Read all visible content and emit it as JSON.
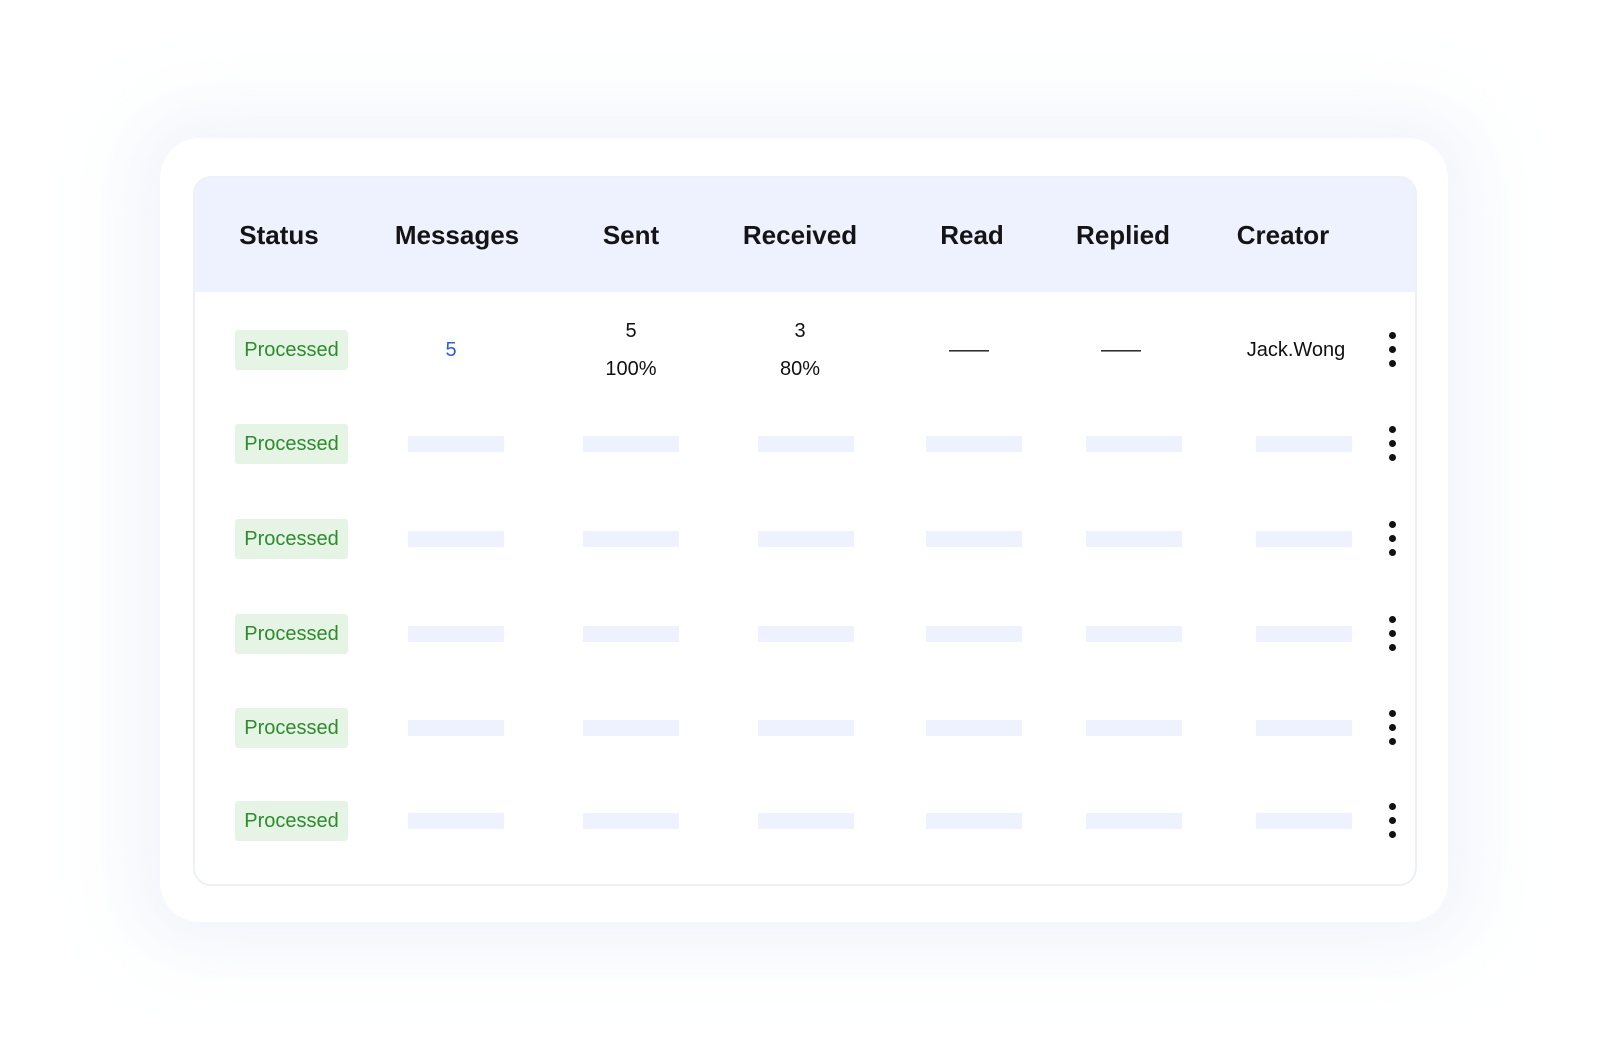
{
  "table": {
    "columns": [
      "Status",
      "Messages",
      "Sent",
      "Received",
      "Read",
      "Replied",
      "Creator"
    ],
    "rows": [
      {
        "status": "Processed",
        "messages": "5",
        "sent_count": "5",
        "sent_pct": "100%",
        "received_count": "3",
        "received_pct": "80%",
        "read": "——",
        "replied": "——",
        "creator": "Jack.Wong"
      },
      {
        "status": "Processed",
        "placeholder": true
      },
      {
        "status": "Processed",
        "placeholder": true
      },
      {
        "status": "Processed",
        "placeholder": true
      },
      {
        "status": "Processed",
        "placeholder": true
      },
      {
        "status": "Processed",
        "placeholder": true
      }
    ]
  },
  "icons": {
    "row_menu": "more-vertical-icon"
  },
  "colors": {
    "header_bg": "#edf2fe",
    "badge_bg": "#e6f4e6",
    "badge_text": "#2e8b2e",
    "link": "#2f5bd8",
    "placeholder": "#edf2fe"
  }
}
